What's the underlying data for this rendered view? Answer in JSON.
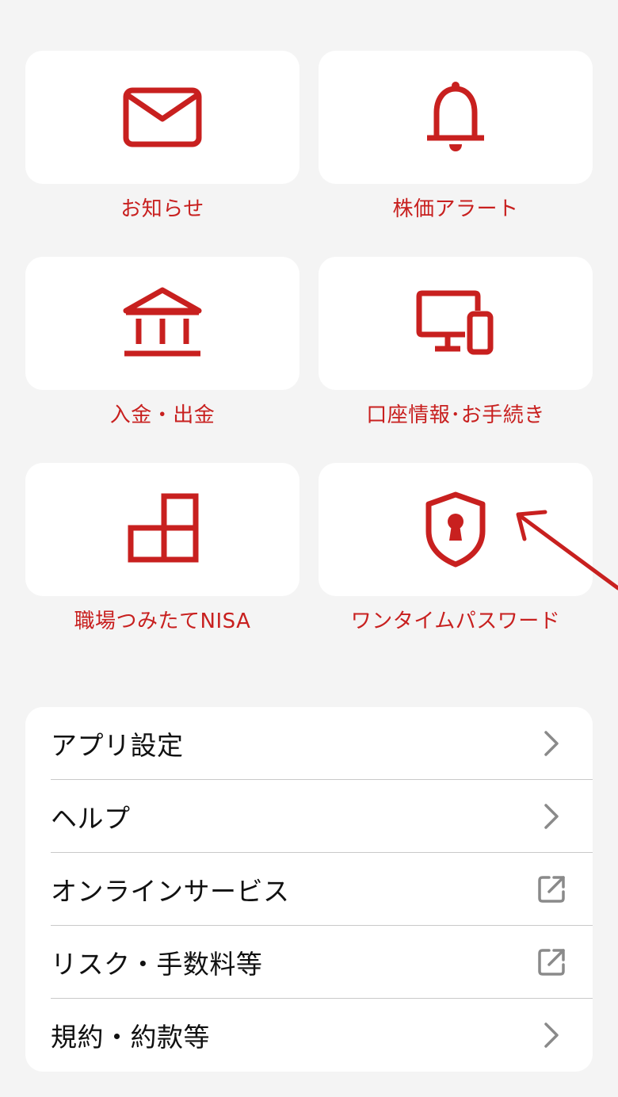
{
  "tiles": [
    {
      "label": "お知らせ",
      "icon": "envelope-icon"
    },
    {
      "label": "株価アラート",
      "icon": "bell-icon"
    },
    {
      "label": "入金・出金",
      "icon": "bank-icon"
    },
    {
      "label": "口座情報･お手続き",
      "icon": "devices-icon"
    },
    {
      "label": "職場つみたてNISA",
      "icon": "blocks-icon"
    },
    {
      "label": "ワンタイムパスワード",
      "icon": "shield-lock-icon"
    }
  ],
  "menu": [
    {
      "label": "アプリ設定",
      "trail": "chevron-right-icon"
    },
    {
      "label": "ヘルプ",
      "trail": "chevron-right-icon"
    },
    {
      "label": "オンラインサービス",
      "trail": "external-link-icon"
    },
    {
      "label": "リスク・手数料等",
      "trail": "external-link-icon"
    },
    {
      "label": "規約・約款等",
      "trail": "chevron-right-icon"
    }
  ],
  "colors": {
    "accent": "#c8201f",
    "background": "#f4f4f4",
    "card": "#ffffff",
    "chevron": "#8a8a8a"
  }
}
